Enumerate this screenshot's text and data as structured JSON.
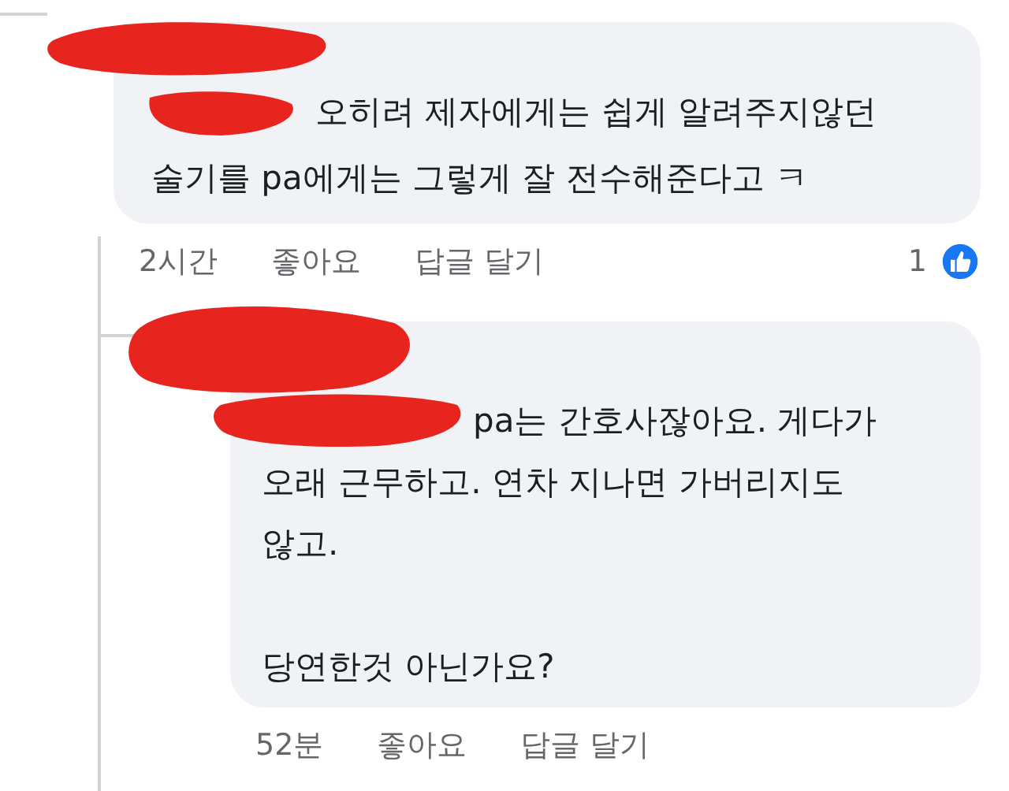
{
  "comments": [
    {
      "text": "오히려 제자에게는 쉽게 알려주지않던\n술기를 pa에게는 그렇게 잘 전수해준다고 ㅋ",
      "time": "2시간",
      "actions": [
        "좋아요",
        "답글 달기"
      ],
      "reaction_count": "1"
    },
    {
      "text": "pa는 간호사잖아요. 게다가\n오래 근무하고. 연차 지나면 가버리지도\n않고.\n\n당연한것 아닌가요?",
      "time": "52분",
      "actions": [
        "좋아요",
        "답글 달기"
      ]
    }
  ]
}
